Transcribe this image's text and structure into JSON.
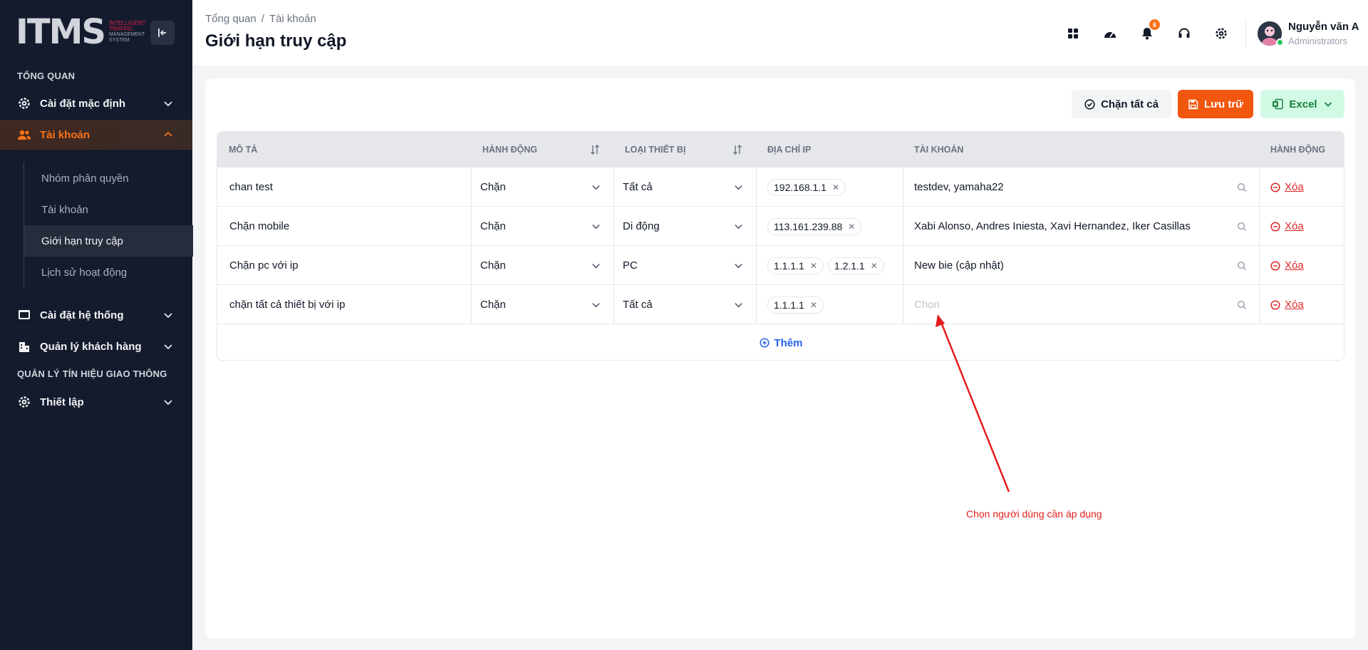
{
  "sidebar": {
    "brand": {
      "mark": "ITMS",
      "line1": "INTELLIGENT",
      "line2": "TRAFFIC",
      "line3": "MANAGEMENT",
      "line4": "SYSTEM"
    },
    "section_overview": "TỔNG QUAN",
    "items": [
      {
        "label": "Cài đặt mặc định"
      },
      {
        "label": "Tài khoản"
      },
      {
        "label": "Cài đặt hệ thống"
      },
      {
        "label": "Quản lý khách hàng"
      }
    ],
    "sub_items": [
      {
        "label": "Nhóm phân quyền"
      },
      {
        "label": "Tài khoản"
      },
      {
        "label": "Giới hạn truy cập"
      },
      {
        "label": "Lịch sử hoạt động"
      }
    ],
    "section_traffic": "QUẢN LÝ TÍN HIỆU GIAO THÔNG",
    "traffic_items": [
      {
        "label": "Thiết lập"
      }
    ]
  },
  "header": {
    "breadcrumb": [
      "Tổng quan",
      "Tài khoản"
    ],
    "title": "Giới hạn truy cập",
    "notification_count": "6",
    "user": {
      "name": "Nguyễn văn A",
      "role": "Administrators"
    }
  },
  "toolbar": {
    "block_all_label": "Chặn tất cả",
    "save_label": "Lưu trữ",
    "excel_label": "Excel"
  },
  "table": {
    "columns": [
      "MÔ TẢ",
      "HÀNH ĐỘNG",
      "LOẠI THIẾT BỊ",
      "ĐỊA CHỈ IP",
      "TÀI KHOẢN",
      "HÀNH ĐỘNG"
    ],
    "rows": [
      {
        "description": "chan test",
        "action": "Chặn",
        "device": "Tất cả",
        "ips": [
          "192.168.1.1"
        ],
        "accounts": "testdev, yamaha22",
        "delete": "Xóa"
      },
      {
        "description": "Chặn mobile",
        "action": "Chặn",
        "device": "Di động",
        "ips": [
          "113.161.239.88"
        ],
        "accounts": "Xabi Alonso, Andres Iniesta, Xavi Hernandez, Iker Casillas",
        "delete": "Xóa"
      },
      {
        "description": "Chặn pc với ip",
        "action": "Chặn",
        "device": "PC",
        "ips": [
          "1.1.1.1",
          "1.2.1.1"
        ],
        "accounts": "New bie (cập nhật)",
        "delete": "Xóa"
      },
      {
        "description": "chặn tất cả thiết bị với ip",
        "action": "Chặn",
        "device": "Tất cả",
        "ips": [
          "1.1.1.1"
        ],
        "accounts_placeholder": "Chọn",
        "delete": "Xóa"
      }
    ],
    "add_label": "Thêm"
  },
  "annotation": {
    "text": "Chọn người dùng cần áp dụng",
    "color": "#e11d1d"
  },
  "colors": {
    "sidebar_bg": "#141b2d",
    "accent_orange": "#f2570f",
    "excel_green": "#15803d",
    "danger": "#dc2626",
    "link_blue": "#2563eb"
  }
}
